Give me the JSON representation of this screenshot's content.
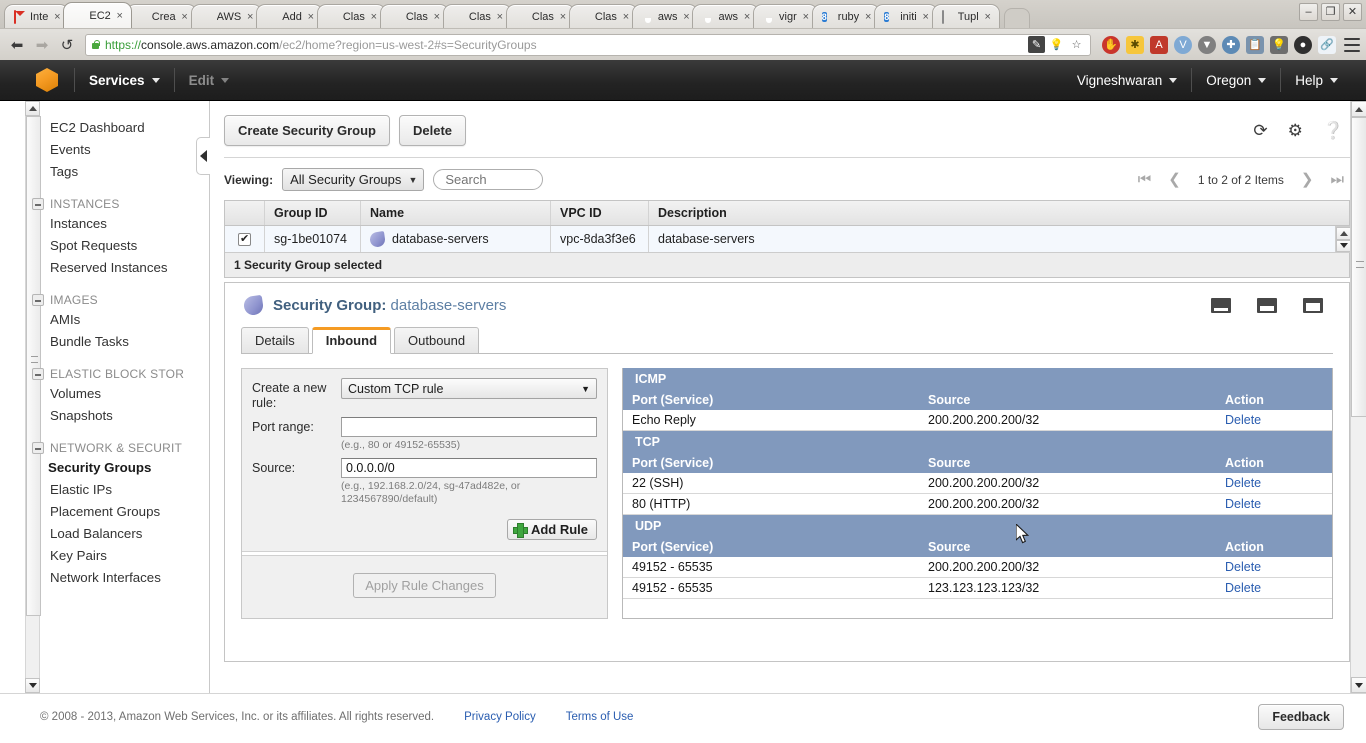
{
  "browser": {
    "tabs": [
      {
        "label": "Inte",
        "icon": "gmail-icon",
        "active": false
      },
      {
        "label": "EC2",
        "icon": "aws-cube-icon",
        "active": true
      },
      {
        "label": "Crea",
        "icon": "aws-cube-icon",
        "active": false
      },
      {
        "label": "AWS",
        "icon": "aws-cube-icon",
        "active": false
      },
      {
        "label": "Add",
        "icon": "aws-cube-icon",
        "active": false
      },
      {
        "label": "Clas",
        "icon": "aws-cube-icon",
        "active": false
      },
      {
        "label": "Clas",
        "icon": "aws-cube-icon",
        "active": false
      },
      {
        "label": "Clas",
        "icon": "aws-cube-icon",
        "active": false
      },
      {
        "label": "Clas",
        "icon": "aws-cube-icon",
        "active": false
      },
      {
        "label": "Clas",
        "icon": "aws-cube-icon",
        "active": false
      },
      {
        "label": "aws",
        "icon": "github-icon",
        "active": false
      },
      {
        "label": "aws",
        "icon": "github-icon",
        "active": false
      },
      {
        "label": "vigr",
        "icon": "github-icon",
        "active": false
      },
      {
        "label": "ruby",
        "icon": "blue-8-icon",
        "active": false
      },
      {
        "label": "initi",
        "icon": "blue-8-icon",
        "active": false
      },
      {
        "label": "Tupl",
        "icon": "document-icon",
        "active": false
      }
    ],
    "tab_close_label": "×",
    "window_controls": {
      "minimize": "‒",
      "maximize": "❐",
      "close": "✕"
    },
    "nav": {
      "back": "←",
      "forward": "→",
      "reload": "↺"
    },
    "url": {
      "scheme": "https://",
      "host": "console.aws.amazon.com",
      "path": "/ec2/home?region=us-west-2#s=SecurityGroups",
      "full": "https://console.aws.amazon.com/ec2/home?region=us-west-2#s=SecurityGroups"
    }
  },
  "aws_header": {
    "logo": "aws-cube-logo",
    "services_label": "Services",
    "edit_label": "Edit",
    "user_label": "Vigneshwaran",
    "region_label": "Oregon",
    "help_label": "Help"
  },
  "sidebar": {
    "top_links": [
      "EC2 Dashboard",
      "Events",
      "Tags"
    ],
    "groups": [
      {
        "title": "INSTANCES",
        "items": [
          "Instances",
          "Spot Requests",
          "Reserved Instances"
        ]
      },
      {
        "title": "IMAGES",
        "items": [
          "AMIs",
          "Bundle Tasks"
        ]
      },
      {
        "title": "ELASTIC BLOCK STOR",
        "items": [
          "Volumes",
          "Snapshots"
        ]
      },
      {
        "title": "NETWORK & SECURIT",
        "items": [
          "Security Groups",
          "Elastic IPs",
          "Placement Groups",
          "Load Balancers",
          "Key Pairs",
          "Network Interfaces"
        ]
      }
    ],
    "active_item": "Security Groups"
  },
  "toolbar": {
    "create_label": "Create Security Group",
    "delete_label": "Delete",
    "refresh_icon": "refresh-icon",
    "gear_icon": "gear-icon",
    "help_icon": "help-icon"
  },
  "filters": {
    "viewing_label": "Viewing:",
    "filter_value": "All Security Groups",
    "search_placeholder": "Search",
    "search_value": ""
  },
  "pager": {
    "first": "⏮",
    "prev": "❮",
    "text": "1 to 2 of 2 Items",
    "next": "❯",
    "last": "⏭"
  },
  "grid": {
    "columns": [
      "",
      "Group ID",
      "Name",
      "VPC ID",
      "Description"
    ],
    "rows": [
      {
        "checked": true,
        "group_id": "sg-1be01074",
        "name": "database-servers",
        "vpc_id": "vpc-8da3f3e6",
        "description": "database-servers"
      }
    ],
    "selection_status": "1 Security Group selected"
  },
  "detail": {
    "title_prefix": "Security Group:",
    "title_value": "database-servers",
    "tabs": [
      {
        "label": "Details",
        "selected": false
      },
      {
        "label": "Inbound",
        "selected": true
      },
      {
        "label": "Outbound",
        "selected": false
      }
    ],
    "form": {
      "rule_label": "Create a new rule:",
      "rule_value": "Custom TCP rule",
      "port_label": "Port range:",
      "port_value": "",
      "port_hint": "(e.g., 80 or 49152-65535)",
      "source_label": "Source:",
      "source_value": "0.0.0.0/0",
      "source_hint": "(e.g., 192.168.2.0/24, sg-47ad482e, or 1234567890/default)",
      "add_rule_label": "Add Rule",
      "apply_label": "Apply Rule Changes"
    },
    "rules_columns": [
      "Port (Service)",
      "Source",
      "Action"
    ],
    "rules_groups": [
      {
        "protocol": "ICMP",
        "rows": [
          {
            "port": "Echo Reply",
            "source": "200.200.200.200/32",
            "action": "Delete"
          }
        ]
      },
      {
        "protocol": "TCP",
        "rows": [
          {
            "port": "22 (SSH)",
            "source": "200.200.200.200/32",
            "action": "Delete"
          },
          {
            "port": "80 (HTTP)",
            "source": "200.200.200.200/32",
            "action": "Delete"
          }
        ]
      },
      {
        "protocol": "UDP",
        "rows": [
          {
            "port": "49152 - 65535",
            "source": "200.200.200.200/32",
            "action": "Delete"
          },
          {
            "port": "49152 - 65535",
            "source": "123.123.123.123/32",
            "action": "Delete"
          }
        ]
      }
    ]
  },
  "footer": {
    "copyright": "© 2008 - 2013, Amazon Web Services, Inc. or its affiliates. All rights reserved.",
    "privacy_label": "Privacy Policy",
    "terms_label": "Terms of Use",
    "feedback_label": "Feedback"
  },
  "colors": {
    "aws_orange": "#f59b23",
    "rules_header_blue": "#8199bd",
    "link_blue": "#2a5db0",
    "row_selected": "#f4f8fd"
  }
}
